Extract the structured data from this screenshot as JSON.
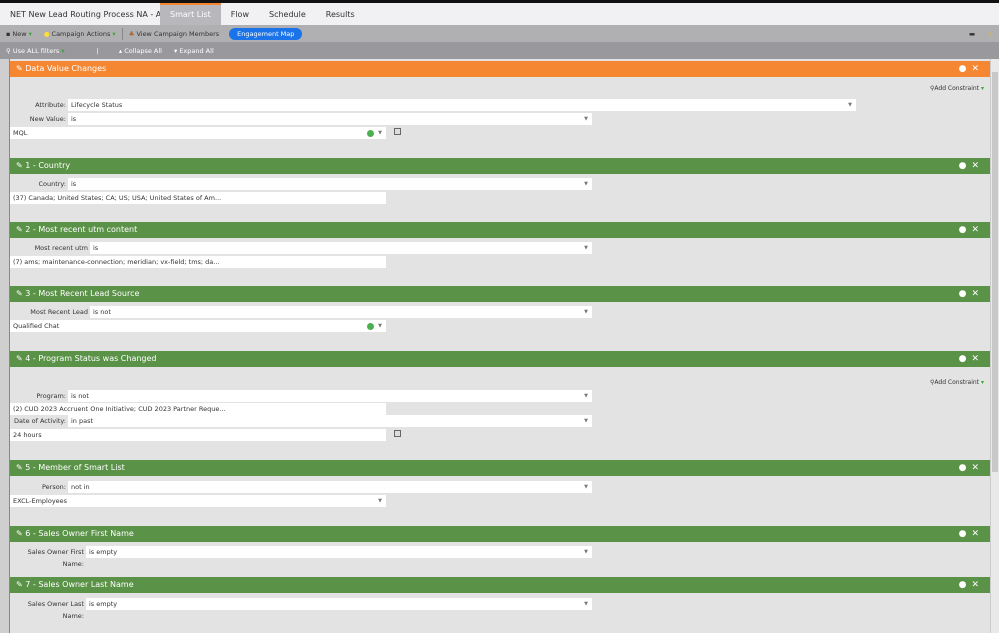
{
  "tabs": {
    "title": "NET New Lead Routing Process NA - AMS...",
    "items": [
      "Smart List",
      "Flow",
      "Schedule",
      "Results"
    ],
    "active": "Smart List"
  },
  "toolbar": {
    "new": "New",
    "campaign_actions": "Campaign Actions",
    "view_members": "View Campaign Members",
    "engagement_map": "Engagement Map"
  },
  "filterbar": {
    "use_filters": "Use ALL filters",
    "collapse": "Collapse All",
    "expand": "Expand All"
  },
  "add_constraint": "Add Constraint",
  "filters": [
    {
      "title": "Data Value Changes",
      "color": "#f58733",
      "constraint": true,
      "rows": [
        {
          "label": "Attribute:",
          "value": "Lifecycle Status",
          "wide": true
        },
        {
          "label": "New Value:",
          "value": "is"
        },
        {
          "field": "MQL",
          "plus": true,
          "xbox": true
        }
      ]
    },
    {
      "title": "1 - Country",
      "color": "#5a9247",
      "rows": [
        {
          "label": "Country:",
          "value": "is"
        },
        {
          "field": "(37) Canada; United States; CA; US; USA; United States of Am..."
        }
      ]
    },
    {
      "title": "2 - Most recent utm content",
      "color": "#5a9247",
      "rows": [
        {
          "label": "Most recent utm content:",
          "value": "is"
        },
        {
          "field": "(7) ams; maintenance-connection; meridian; vx-field; tms; da..."
        }
      ]
    },
    {
      "title": "3 - Most Recent Lead Source",
      "color": "#5a9247",
      "rows": [
        {
          "label": "Most Recent Lead Source:",
          "value": "is not"
        },
        {
          "field": "Qualified Chat",
          "plus": true
        }
      ]
    },
    {
      "title": "4 - Program Status was Changed",
      "color": "#5a9247",
      "constraint": true,
      "rows": [
        {
          "label": "Program:",
          "value": "is not"
        },
        {
          "field": "(2) CUD 2023 Accruent One Initiative; CUD 2023 Partner Reque..."
        },
        {
          "label": "Date of Activity:",
          "value": "in past"
        },
        {
          "field": "24 hours",
          "xbox": true
        }
      ]
    },
    {
      "title": "5 - Member of Smart List",
      "color": "#5a9247",
      "rows": [
        {
          "label": "Person:",
          "value": "not in"
        },
        {
          "field": "EXCL-Employees",
          "arrow": true
        }
      ]
    },
    {
      "title": "6 - Sales Owner First Name",
      "color": "#5a9247",
      "rows": [
        {
          "label": "Sales Owner First Name:",
          "value": "is empty"
        }
      ]
    },
    {
      "title": "7 - Sales Owner Last Name",
      "color": "#5a9247",
      "rows": [
        {
          "label": "Sales Owner Last Name:",
          "value": "is empty"
        }
      ]
    }
  ]
}
